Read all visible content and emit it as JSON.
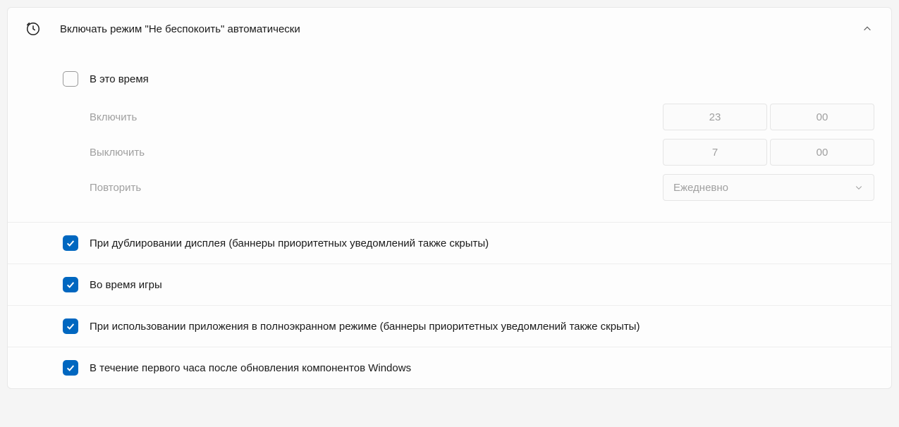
{
  "header": {
    "title": "Включать режим \"Не беспокоить\" автоматически"
  },
  "options": {
    "duringTime": {
      "label": "В это время",
      "checked": false,
      "enable": {
        "label": "Включить",
        "hour": "23",
        "minute": "00"
      },
      "disable": {
        "label": "Выключить",
        "hour": "7",
        "minute": "00"
      },
      "repeat": {
        "label": "Повторить",
        "value": "Ежедневно"
      }
    },
    "duplicateDisplay": {
      "label": "При дублировании дисплея (баннеры приоритетных уведомлений также скрыты)",
      "checked": true
    },
    "gaming": {
      "label": "Во время игры",
      "checked": true
    },
    "fullscreen": {
      "label": "При использовании приложения в полноэкранном режиме (баннеры приоритетных уведомлений также скрыты)",
      "checked": true
    },
    "afterUpdate": {
      "label": "В течение первого часа после обновления компонентов Windows",
      "checked": true
    }
  }
}
